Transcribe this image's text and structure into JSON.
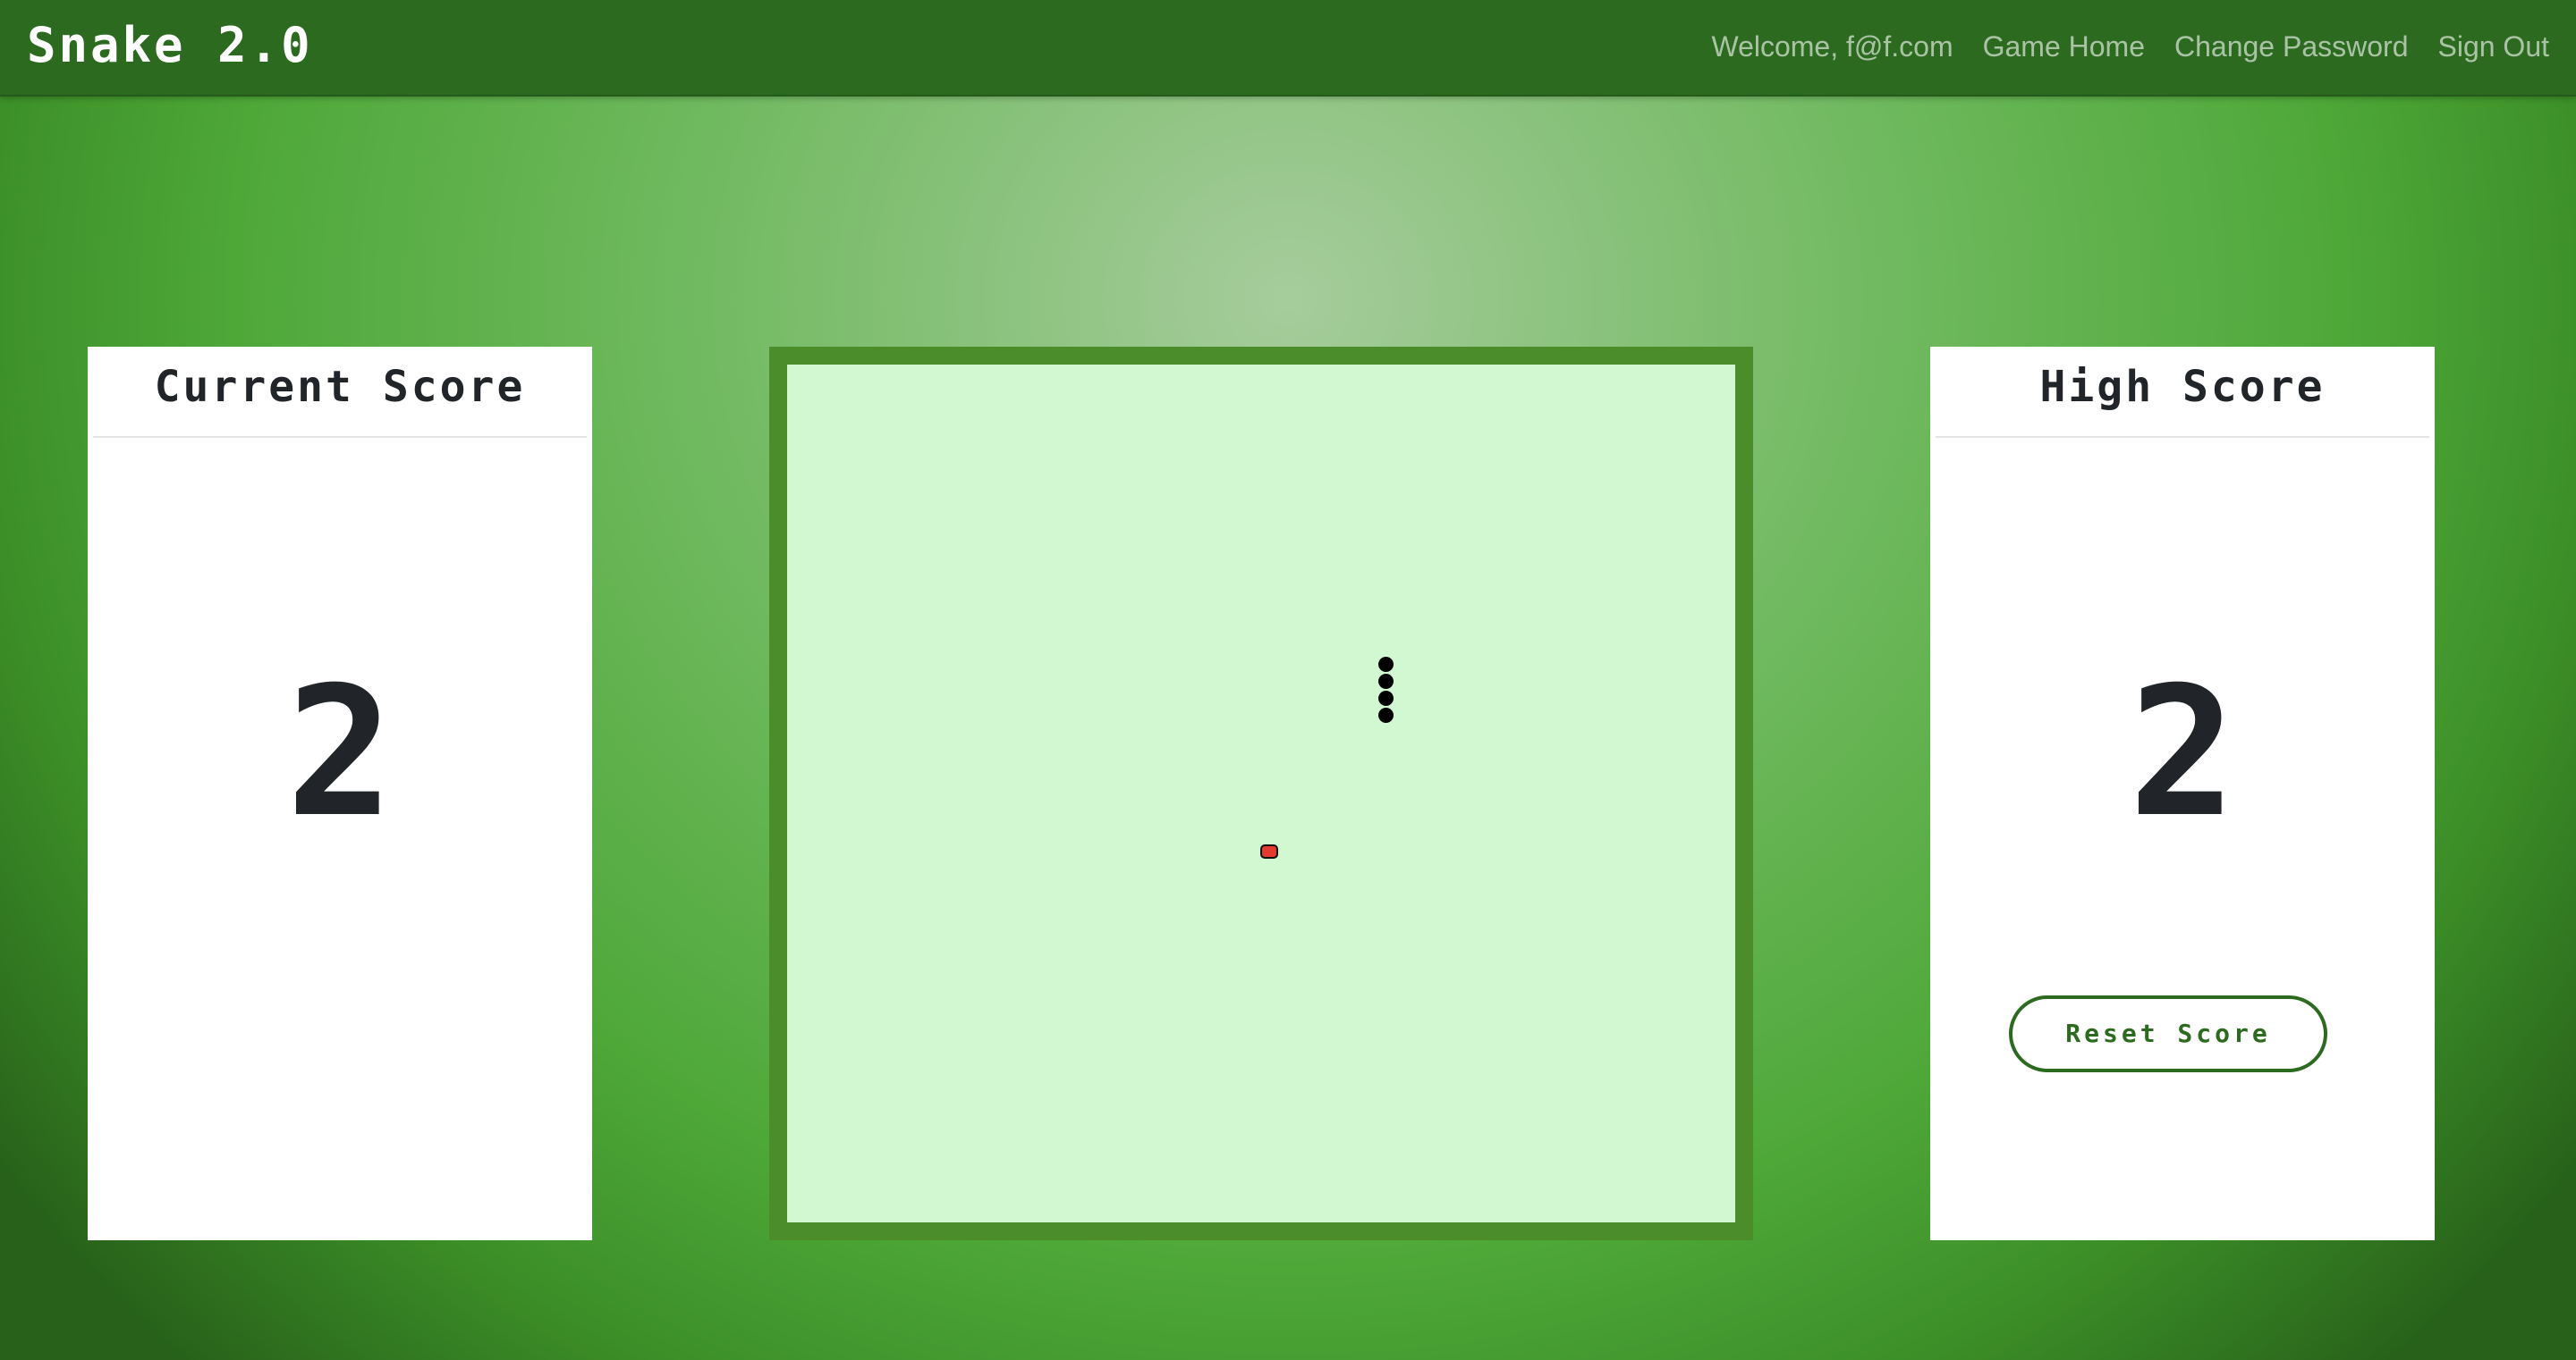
{
  "app": {
    "brand": "Snake 2.0"
  },
  "nav": {
    "welcome": "Welcome, f@f.com",
    "game_home": "Game Home",
    "change_password": "Change Password",
    "sign_out": "Sign Out"
  },
  "current_score": {
    "title": "Current Score",
    "value": "2"
  },
  "high_score": {
    "title": "High Score",
    "value": "2",
    "reset_label": "Reset Score"
  },
  "board": {
    "snake_segments": 4,
    "food_color": "#e53b2e"
  },
  "colors": {
    "navbar": "#2b6a1f",
    "board_border": "#4b8d2a",
    "board_fill": "#d2f8d2",
    "button_accent": "#2b6a1f"
  }
}
